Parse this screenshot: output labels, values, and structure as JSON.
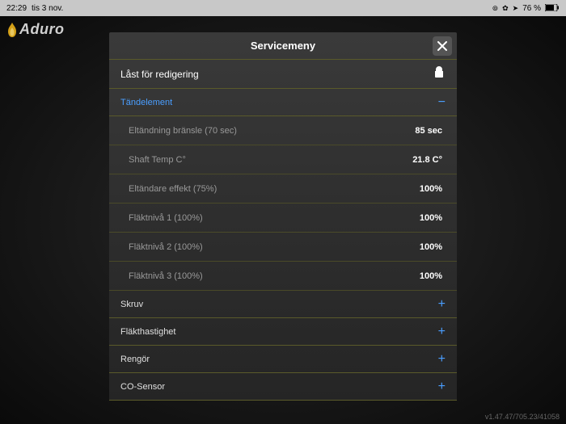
{
  "status_bar": {
    "time": "22:29",
    "date": "tis 3 nov.",
    "battery": "76 %"
  },
  "brand": "Aduro",
  "panel": {
    "title": "Servicemeny",
    "lock_label": "Låst för redigering"
  },
  "sections": {
    "tandelement": {
      "title": "Tändelement",
      "toggle": "−",
      "rows": [
        {
          "label": "Eltändning bränsle (70 sec)",
          "value": "85 sec"
        },
        {
          "label": "Shaft Temp C°",
          "value": "21.8 C°"
        },
        {
          "label": "Eltändare effekt (75%)",
          "value": "100%"
        },
        {
          "label": "Fläktnivå 1 (100%)",
          "value": "100%"
        },
        {
          "label": "Fläktnivå 2 (100%)",
          "value": "100%"
        },
        {
          "label": "Fläktnivå 3 (100%)",
          "value": "100%"
        }
      ]
    },
    "skruv": {
      "title": "Skruv",
      "toggle": "+"
    },
    "flakthastighet": {
      "title": "Fläkthastighet",
      "toggle": "+"
    },
    "rengor": {
      "title": "Rengör",
      "toggle": "+"
    },
    "cosensor": {
      "title": "CO-Sensor",
      "toggle": "+"
    }
  },
  "version": "v1.47.47/705.23/41058"
}
